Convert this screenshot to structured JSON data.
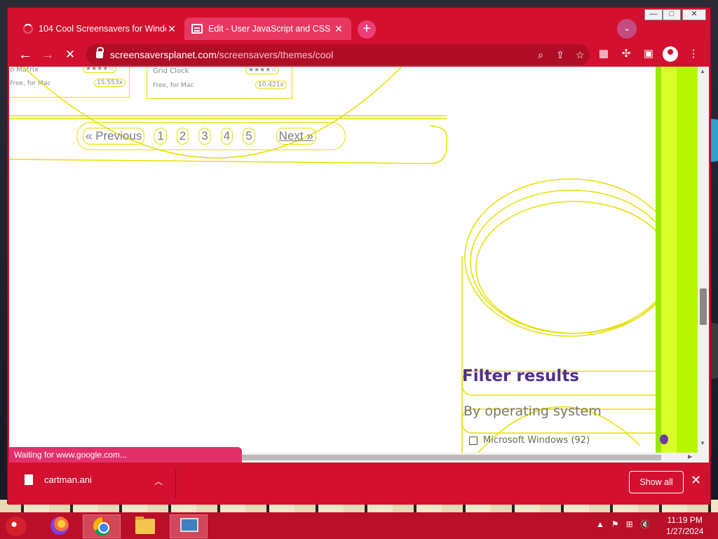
{
  "tabs": [
    {
      "title": "104 Cool Screensavers for Windo",
      "close": "✕"
    },
    {
      "title": "Edit - User JavaScript and CSS",
      "close": "✕"
    }
  ],
  "window_controls": {
    "minimize": "—",
    "maximize": "□",
    "close": "✕"
  },
  "toolbar": {
    "url_domain": "screensaversplanet.com",
    "url_path": "/screensavers/themes/cool"
  },
  "page": {
    "top_cards": [
      {
        "name": "o Matrix",
        "rating": "★★★★☆",
        "platform": "Free, for Mac",
        "downloads": "15,553x"
      },
      {
        "name": "Grid Clock",
        "rating": "★★★★☆",
        "platform": "Free, for Mac",
        "downloads": "10,421x"
      }
    ],
    "pagination": {
      "previous": "« Previous",
      "pages": [
        "1",
        "2",
        "3",
        "4",
        "5"
      ],
      "next": "Next",
      "next_arrow": " »"
    },
    "filter_title": "Filter results",
    "os_title": "By operating system",
    "os_items": [
      {
        "label": "Microsoft Windows (92)"
      }
    ]
  },
  "status_text": "Waiting for www.google.com...",
  "downloads": {
    "file": "cartman.ani",
    "show_all": "Show all"
  },
  "taskbar": {
    "time": "11:19 PM",
    "date": "1/27/2024"
  }
}
